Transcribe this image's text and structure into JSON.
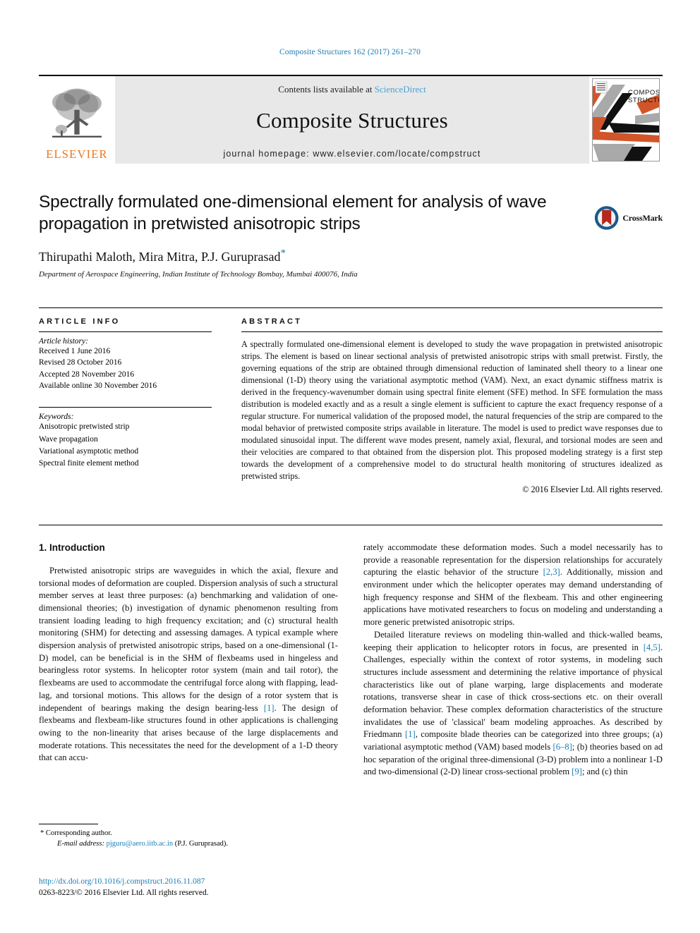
{
  "running_head": "Composite Structures 162 (2017) 261–270",
  "masthead": {
    "publisher_name": "ELSEVIER",
    "contents_prefix": "Contents lists available at ",
    "contents_link": "ScienceDirect",
    "journal_title": "Composite Structures",
    "homepage_line": "journal homepage: www.elsevier.com/locate/compstruct",
    "cover_title_line1": "COMPOSITE",
    "cover_title_line2": "STRUCTURES"
  },
  "title_block": {
    "title": "Spectrally formulated one-dimensional element for analysis of wave propagation in pretwisted anisotropic strips",
    "authors": "Thirupathi Maloth, Mira Mitra, P.J. Guruprasad",
    "corresponding_marker": "*",
    "affiliation": "Department of Aerospace Engineering, Indian Institute of Technology Bombay, Mumbai 400076, India",
    "crossmark_label": "CrossMark"
  },
  "article_info": {
    "heading": "ARTICLE INFO",
    "history_label": "Article history:",
    "history": [
      "Received 1 June 2016",
      "Revised 28 October 2016",
      "Accepted 28 November 2016",
      "Available online 30 November 2016"
    ],
    "keywords_label": "Keywords:",
    "keywords": [
      "Anisotropic pretwisted strip",
      "Wave propagation",
      "Variational asymptotic method",
      "Spectral finite element method"
    ]
  },
  "abstract": {
    "heading": "ABSTRACT",
    "text": "A spectrally formulated one-dimensional element is developed to study the wave propagation in pretwisted anisotropic strips. The element is based on linear sectional analysis of pretwisted anisotropic strips with small pretwist. Firstly, the governing equations of the strip are obtained through dimensional reduction of laminated shell theory to a linear one dimensional (1-D) theory using the variational asymptotic method (VAM). Next, an exact dynamic stiffness matrix is derived in the frequency-wavenumber domain using spectral finite element (SFE) method. In SFE formulation the mass distribution is modeled exactly and as a result a single element is sufficient to capture the exact frequency response of a regular structure. For numerical validation of the proposed model, the natural frequencies of the strip are compared to the modal behavior of pretwisted composite strips available in literature. The model is used to predict wave responses due to modulated sinusoidal input. The different wave modes present, namely axial, flexural, and torsional modes are seen and their velocities are compared to that obtained from the dispersion plot. This proposed modeling strategy is a first step towards the development of a comprehensive model to do structural health monitoring of structures idealized as pretwisted strips.",
    "copyright": "© 2016 Elsevier Ltd. All rights reserved."
  },
  "body": {
    "section_number_title": "1. Introduction",
    "left_para_1_a": "Pretwisted anisotropic strips are waveguides in which the axial, flexure and torsional modes of deformation are coupled. Dispersion analysis of such a structural member serves at least three purposes: (a) benchmarking and validation of one-dimensional theories; (b) investigation of dynamic phenomenon resulting from transient loading leading to high frequency excitation; and (c) structural health monitoring (SHM) for detecting and assessing damages. A typical example where dispersion analysis of pretwisted anisotropic strips, based on a one-dimensional (1-D) model, can be beneficial is in the SHM of flexbeams used in hingeless and bearingless rotor systems. In helicopter rotor system (main and tail rotor), the flexbeams are used to accommodate the centrifugal force along with flapping, lead-lag, and torsional motions. This allows for the design of a rotor system that is independent of bearings making the design bearing-less ",
    "left_ref_1": "[1]",
    "left_para_1_b": ". The design of flexbeams and flexbeam-like structures found in other applications is challenging owing to the non-linearity that arises because of the large displacements and moderate rotations. This necessitates the need for the development of a 1-D theory that can accu-",
    "right_para_1_a": "rately accommodate these deformation modes. Such a model necessarily has to provide a reasonable representation for the dispersion relationships for accurately capturing the elastic behavior of the structure ",
    "right_ref_1": "[2,3]",
    "right_para_1_b": ". Additionally, mission and environment under which the helicopter operates may demand understanding of high frequency response and SHM of the flexbeam. This and other engineering applications have motivated researchers to focus on modeling and understanding a more generic pretwisted anisotropic strips.",
    "right_para_2_a": "Detailed literature reviews on modeling thin-walled and thick-walled beams, keeping their application to helicopter rotors in focus, are presented in ",
    "right_ref_2": "[4,5]",
    "right_para_2_b": ". Challenges, especially within the context of rotor systems, in modeling such structures include assessment and determining the relative importance of physical characteristics like out of plane warping, large displacements and moderate rotations, transverse shear in case of thick cross-sections etc. on their overall deformation behavior. These complex deformation characteristics of the structure invalidates the use of 'classical' beam modeling approaches. As described by Friedmann ",
    "right_ref_3": "[1]",
    "right_para_2_c": ", composite blade theories can be categorized into three groups; (a) variational asymptotic method (VAM) based models ",
    "right_ref_4": "[6–8]",
    "right_para_2_d": "; (b) theories based on ad hoc separation of the original three-dimensional (3-D) problem into a nonlinear 1-D and two-dimensional (2-D) linear cross-sectional problem ",
    "right_ref_5": "[9]",
    "right_para_2_e": "; and (c) thin"
  },
  "footnote": {
    "corresponding_marker": "*",
    "corresponding_text": "Corresponding author.",
    "email_label": "E-mail address:",
    "email": "pjguru@aero.iitb.ac.in",
    "email_owner": "(P.J. Guruprasad)."
  },
  "footer": {
    "doi": "http://dx.doi.org/10.1016/j.compstruct.2016.11.087",
    "issn_line": "0263-8223/© 2016 Elsevier Ltd. All rights reserved."
  },
  "colors": {
    "link_blue": "#1a7db5",
    "sciencedirect_blue": "#4aa3d6",
    "elsevier_orange": "#e87722",
    "band_gray": "#e8e8e8"
  }
}
